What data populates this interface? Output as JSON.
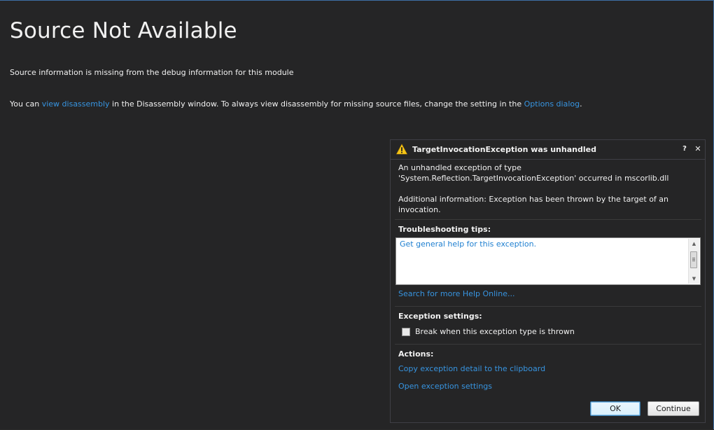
{
  "page": {
    "title": "Source Not Available",
    "info": "Source information is missing from the debug information for this module",
    "para_prefix": "You can ",
    "link_disassembly": "view disassembly",
    "para_middle": " in the Disassembly window. To always view disassembly for missing source files, change the setting in the ",
    "link_options": "Options dialog",
    "para_suffix": "."
  },
  "exception": {
    "title": "TargetInvocationException was unhandled",
    "help_glyph": "?",
    "close_glyph": "✕",
    "message": "An unhandled exception of type 'System.Reflection.TargetInvocationException' occurred in mscorlib.dll",
    "additional": "Additional information: Exception has been thrown by the target of an invocation.",
    "tips_header": "Troubleshooting tips:",
    "tips_link": "Get general help for this exception.",
    "search_link": "Search for more Help Online...",
    "settings_header": "Exception settings:",
    "break_label": "Break when this exception type is thrown",
    "break_checked": false,
    "actions_header": "Actions:",
    "action_copy": "Copy exception detail to the clipboard",
    "action_open": "Open exception settings",
    "ok_label": "OK",
    "continue_label": "Continue"
  },
  "icons": {
    "warning": "warning-icon",
    "help": "help-icon",
    "close": "close-icon",
    "scroll_up": "scroll-up-icon",
    "scroll_down": "scroll-down-icon"
  },
  "colors": {
    "background": "#252526",
    "link": "#3794e0",
    "text": "#f1f1f1",
    "accent_border": "#3e6fa5",
    "warning": "#f5c518"
  }
}
